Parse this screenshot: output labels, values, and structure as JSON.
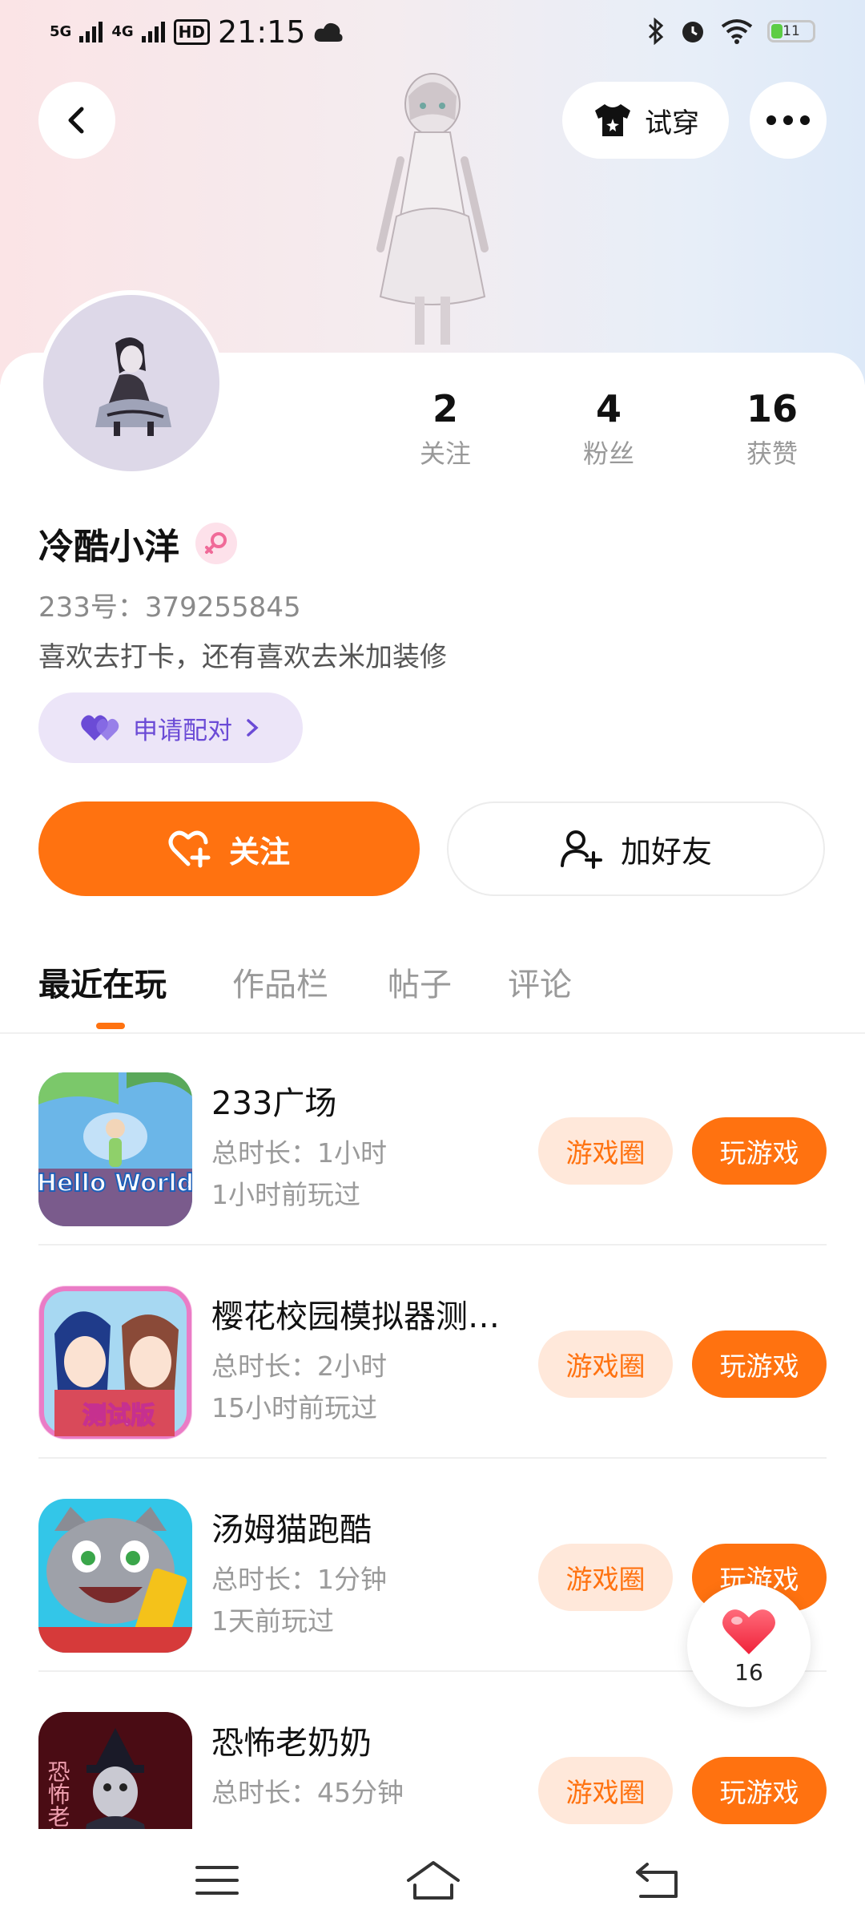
{
  "status_bar": {
    "network_1": "5G",
    "network_2": "4G",
    "hd_label": "HD",
    "time": "21:15",
    "battery_level": "11"
  },
  "header": {
    "try_on_label": "试穿"
  },
  "profile": {
    "stats": [
      {
        "count": "2",
        "label": "关注"
      },
      {
        "count": "4",
        "label": "粉丝"
      },
      {
        "count": "16",
        "label": "获赞"
      }
    ],
    "name": "冷酷小洋",
    "uid": "233号：379255845",
    "bio": "喜欢去打卡，还有喜欢去米加装修",
    "pair_label": "申请配对",
    "follow_label": "关注",
    "add_friend_label": "加好友"
  },
  "tabs": [
    {
      "label": "最近在玩",
      "active": true
    },
    {
      "label": "作品栏",
      "active": false
    },
    {
      "label": "帖子",
      "active": false
    },
    {
      "label": "评论",
      "active": false
    }
  ],
  "games": [
    {
      "title": "233广场",
      "duration": "总时长：1小时",
      "last_played": "1小时前玩过",
      "circle_label": "游戏圈",
      "play_label": "玩游戏",
      "icon_text": "Hello World"
    },
    {
      "title": "樱花校园模拟器测…",
      "duration": "总时长：2小时",
      "last_played": "15小时前玩过",
      "circle_label": "游戏圈",
      "play_label": "玩游戏",
      "icon_text": "测试版"
    },
    {
      "title": "汤姆猫跑酷",
      "duration": "总时长：1分钟",
      "last_played": "1天前玩过",
      "circle_label": "游戏圈",
      "play_label": "玩游戏",
      "icon_text": ""
    },
    {
      "title": "恐怖老奶奶",
      "duration": "总时长：45分钟",
      "last_played": "",
      "circle_label": "游戏圈",
      "play_label": "玩游戏",
      "icon_text": "恐怖老奶"
    }
  ],
  "like_fab": {
    "count": "16"
  },
  "colors": {
    "accent": "#ff7210",
    "accent_light": "#ffe8da",
    "pair_bg": "#ece5f8",
    "pair_text": "#6b4bd6"
  }
}
